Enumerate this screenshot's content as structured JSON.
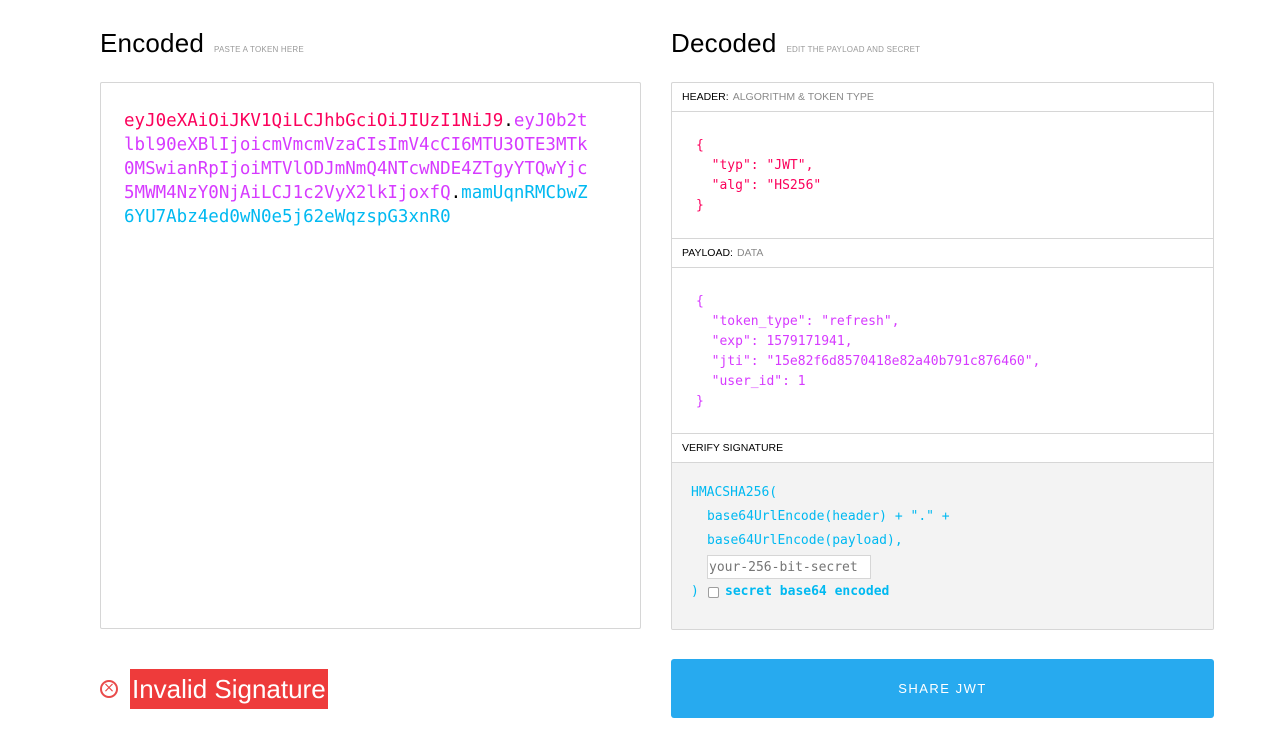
{
  "encoded": {
    "title": "Encoded",
    "subtitle": "PASTE A TOKEN HERE",
    "token_header": "eyJ0eXAiOiJKV1QiLCJhbGciOiJIUzI1NiJ9",
    "token_payload": "eyJ0b2tlbl90eXBlIjoicmVmcmVzaCIsImV4cCI6MTU3OTE3MTk0MSwianRpIjoiMTVlODJmNmQ4NTcwNDE4ZTgyYTQwYjc5MWM4NzY0NjAiLCJ1c2VyX2lkIjoxfQ",
    "token_signature": "mamUqnRMCbwZ6YU7Abz4ed0wN0e5j62eWqzspG3xnR0",
    "dot": "."
  },
  "decoded": {
    "title": "Decoded",
    "subtitle": "EDIT THE PAYLOAD AND SECRET",
    "header_section": {
      "label": "HEADER:",
      "hint": "ALGORITHM & TOKEN TYPE"
    },
    "header_json": "{\n  \"typ\": \"JWT\",\n  \"alg\": \"HS256\"\n}",
    "payload_section": {
      "label": "PAYLOAD:",
      "hint": "DATA"
    },
    "payload_json": "{\n  \"token_type\": \"refresh\",\n  \"exp\": 1579171941,\n  \"jti\": \"15e82f6d8570418e82a40b791c876460\",\n  \"user_id\": 1\n}",
    "verify_section": {
      "label": "VERIFY SIGNATURE"
    },
    "verify": {
      "line1": "HMACSHA256(",
      "line2": "base64UrlEncode(header) + \".\" +",
      "line3": "base64UrlEncode(payload),",
      "secret_placeholder": "your-256-bit-secret",
      "close_paren": ")",
      "base64_label": "secret base64 encoded"
    }
  },
  "status": {
    "icon": "close-circle-icon",
    "text": "Invalid Signature",
    "color": "#ee3b3b"
  },
  "share_button": {
    "label": "SHARE JWT",
    "color": "#27aaef"
  },
  "colors": {
    "header": "#fb015b",
    "payload": "#d63aff",
    "signature": "#00b9f1"
  }
}
